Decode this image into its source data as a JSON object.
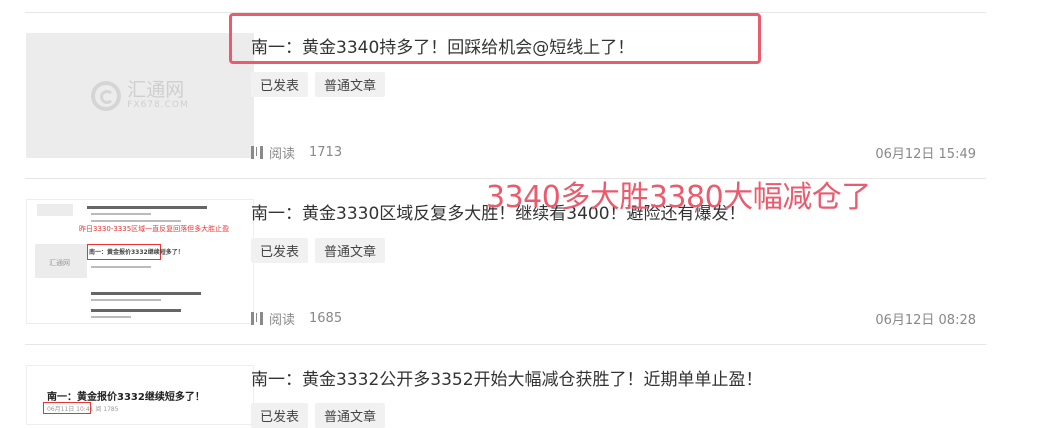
{
  "articles": [
    {
      "title": "南一：黄金3340持多了！回踩给机会@短线上了！",
      "tags": [
        "已发表",
        "普通文章"
      ],
      "read_label": "阅读",
      "reads": "1713",
      "date": "06月12日 15:49",
      "thumb_logo": {
        "cn": "汇通网",
        "en": "FX678.COM"
      }
    },
    {
      "title": "南一：黄金3330区域反复多大胜！继续看3400！避险还有爆发！",
      "tags": [
        "已发表",
        "普通文章"
      ],
      "read_label": "阅读",
      "reads": "1685",
      "date": "06月12日 08:28",
      "thumb_text": {
        "red_line": "昨日3330-3335区域一直反复回落但多大胜止盈",
        "boxed": "南一：黄金报价3332继续短多了！",
        "logo_small": "汇通网"
      }
    },
    {
      "title": "南一：黄金3332公开多3352开始大幅减仓获胜了！近期单单止盈！",
      "tags": [
        "已发表",
        "普通文章"
      ],
      "thumb_text": {
        "heading": "南一：黄金报价3332继续短多了！",
        "sub": "06月11日 10:41  阅 1785"
      }
    }
  ],
  "overlay_note": "3340多大胜3380大幅减仓了",
  "colors": {
    "annotation": "#ea5b6d",
    "tag_bg": "#f1f1f1"
  },
  "icons": [
    "book-icon"
  ]
}
